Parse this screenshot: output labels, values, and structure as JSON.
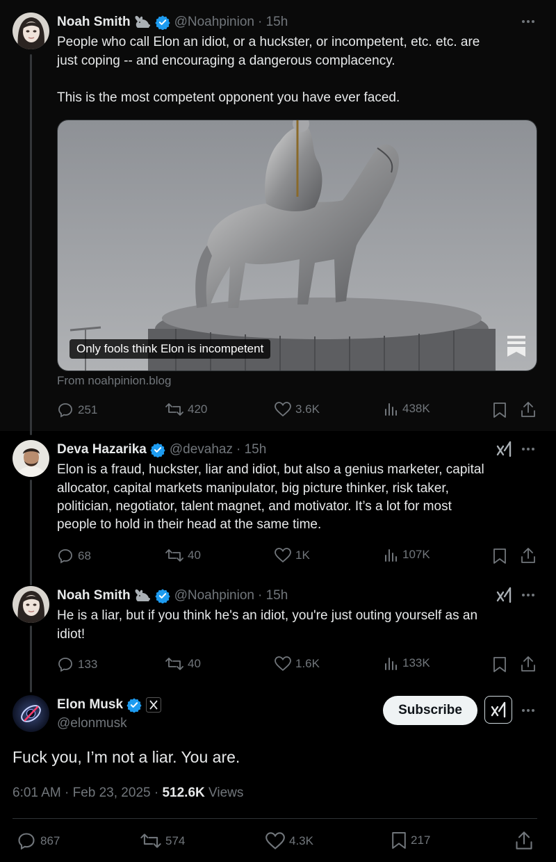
{
  "tweet1": {
    "name": "Noah Smith",
    "handle": "@Noahpinion",
    "time": "· 15h",
    "lines": [
      "People who call Elon an idiot, or a huckster, or incompetent, etc. etc. are",
      "just coping -- and encouraging a dangerous complacency.",
      "",
      "This is the most competent opponent you have ever faced."
    ],
    "card_label": "Only fools think Elon is incompetent",
    "card_from": "From noahpinion.blog",
    "replies": "251",
    "reposts": "420",
    "likes": "3.6K",
    "views": "438K"
  },
  "tweet2": {
    "name": "Deva Hazarika",
    "handle": "@devahaz",
    "time": "· 15h",
    "lines": [
      "Elon is a fraud, huckster, liar and idiot, but also a genius marketer, capital",
      "allocator, capital markets manipulator, big picture thinker, risk taker,",
      "politician, negotiator, talent magnet, and motivator. It’s a lot for most",
      "people to hold in their head at the same time."
    ],
    "replies": "68",
    "reposts": "40",
    "likes": "1K",
    "views": "107K"
  },
  "tweet3": {
    "name": "Noah Smith",
    "handle": "@Noahpinion",
    "time": "· 15h",
    "lines": [
      "He is a liar, but if you think he's an idiot, you're just outing yourself as an",
      "idiot!"
    ],
    "replies": "133",
    "reposts": "40",
    "likes": "1.6K",
    "views": "133K"
  },
  "main": {
    "name": "Elon Musk",
    "handle": "@elonmusk",
    "subscribe_label": "Subscribe",
    "text": "Fuck you, I’m not a liar. You are.",
    "time": "6:01 AM · Feb 23, 2025 · ",
    "views_count": "512.6K",
    "views_label": "Views",
    "replies": "867",
    "reposts": "574",
    "likes": "4.3K",
    "bookmarks": "217"
  },
  "colors": {
    "verified": "#1d9bf0",
    "muted": "#71767b",
    "text": "#e7e9ea"
  },
  "icons": [
    "reply-icon",
    "repost-icon",
    "like-icon",
    "views-icon",
    "bookmark-icon",
    "share-icon",
    "more-icon",
    "grok-icon",
    "verified-icon",
    "rabbit-icon",
    "x-affiliate-icon"
  ]
}
